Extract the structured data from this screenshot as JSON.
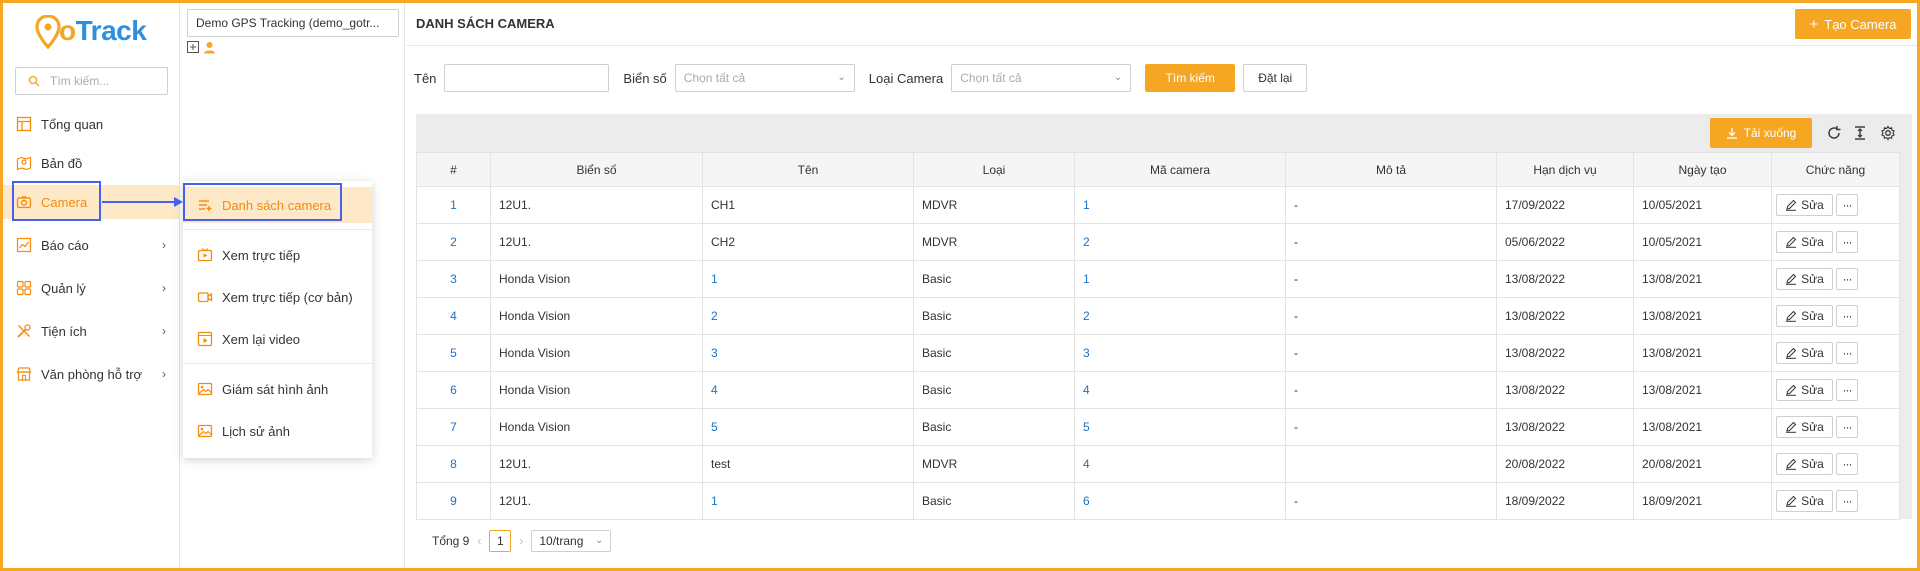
{
  "brand": {
    "logo_text": "GoTrack",
    "accent": "#f5a623",
    "primary": "#2d8fe0"
  },
  "nav": {
    "search_placeholder": "Tìm kiếm...",
    "items": [
      {
        "label": "Tổng quan",
        "icon": "dashboard-icon"
      },
      {
        "label": "Bản đồ",
        "icon": "map-icon"
      },
      {
        "label": "Camera",
        "icon": "camera-icon",
        "active": true
      },
      {
        "label": "Báo cáo",
        "icon": "chart-icon",
        "has_children": true
      },
      {
        "label": "Quản lý",
        "icon": "grid-icon",
        "has_children": true
      },
      {
        "label": "Tiện ích",
        "icon": "tools-icon",
        "has_children": true
      },
      {
        "label": "Văn phòng hỗ trợ",
        "icon": "store-icon",
        "has_children": true
      }
    ]
  },
  "tree": {
    "selected_account": "Demo GPS Tracking (demo_gotr..."
  },
  "submenu": {
    "items": [
      {
        "label": "Danh sách camera",
        "icon": "list-icon",
        "active": true
      },
      {
        "label": "Xem trực tiếp",
        "icon": "live-tv-icon"
      },
      {
        "label": "Xem trực tiếp (cơ bản)",
        "icon": "video-icon"
      },
      {
        "label": "Xem lại video",
        "icon": "playback-icon"
      },
      {
        "label": "Giám sát hình ảnh",
        "icon": "image-icon"
      },
      {
        "label": "Lịch sử ảnh",
        "icon": "image-history-icon"
      }
    ]
  },
  "page": {
    "title": "DANH SÁCH CAMERA",
    "create_label": "Tạo Camera"
  },
  "filters": {
    "name_label": "Tên",
    "plate_label": "Biển số",
    "plate_placeholder": "Chọn tất cả",
    "type_label": "Loại Camera",
    "type_placeholder": "Chọn tất cả",
    "search_label": "Tìm kiếm",
    "reset_label": "Đặt lại"
  },
  "toolbar": {
    "download_label": "Tải xuống"
  },
  "table": {
    "columns": [
      "#",
      "Biển số",
      "Tên",
      "Loại",
      "Mã camera",
      "Mô tả",
      "Hạn dịch vụ",
      "Ngày tạo",
      "Chức năng"
    ],
    "edit_label": "Sửa",
    "more_label": "···",
    "rows": [
      {
        "no": "1",
        "plate": "12U1.",
        "name": "CH1",
        "type": "MDVR",
        "code": "1",
        "desc": "-",
        "expiry": "17/09/2022",
        "created": "10/05/2021"
      },
      {
        "no": "2",
        "plate": "12U1.",
        "name": "CH2",
        "type": "MDVR",
        "code": "2",
        "desc": "-",
        "expiry": "05/06/2022",
        "created": "10/05/2021"
      },
      {
        "no": "3",
        "plate": "Honda Vision",
        "name": "1",
        "type": "Basic",
        "code": "1",
        "desc": "-",
        "expiry": "13/08/2022",
        "created": "13/08/2021"
      },
      {
        "no": "4",
        "plate": "Honda Vision",
        "name": "2",
        "type": "Basic",
        "code": "2",
        "desc": "-",
        "expiry": "13/08/2022",
        "created": "13/08/2021"
      },
      {
        "no": "5",
        "plate": "Honda Vision",
        "name": "3",
        "type": "Basic",
        "code": "3",
        "desc": "-",
        "expiry": "13/08/2022",
        "created": "13/08/2021"
      },
      {
        "no": "6",
        "plate": "Honda Vision",
        "name": "4",
        "type": "Basic",
        "code": "4",
        "desc": "-",
        "expiry": "13/08/2022",
        "created": "13/08/2021"
      },
      {
        "no": "7",
        "plate": "Honda Vision",
        "name": "5",
        "type": "Basic",
        "code": "5",
        "desc": "-",
        "expiry": "13/08/2022",
        "created": "13/08/2021"
      },
      {
        "no": "8",
        "plate": "12U1.",
        "name": "test",
        "type": "MDVR",
        "code": "4",
        "desc": "",
        "expiry": "20/08/2022",
        "created": "20/08/2021"
      },
      {
        "no": "9",
        "plate": "12U1.",
        "name": "1",
        "type": "Basic",
        "code": "6",
        "desc": "-",
        "expiry": "18/09/2022",
        "created": "18/09/2021"
      }
    ]
  },
  "pagination": {
    "total": "Tổng 9",
    "prev": "‹",
    "current": "1",
    "next": "›",
    "page_size": "10/trang"
  }
}
